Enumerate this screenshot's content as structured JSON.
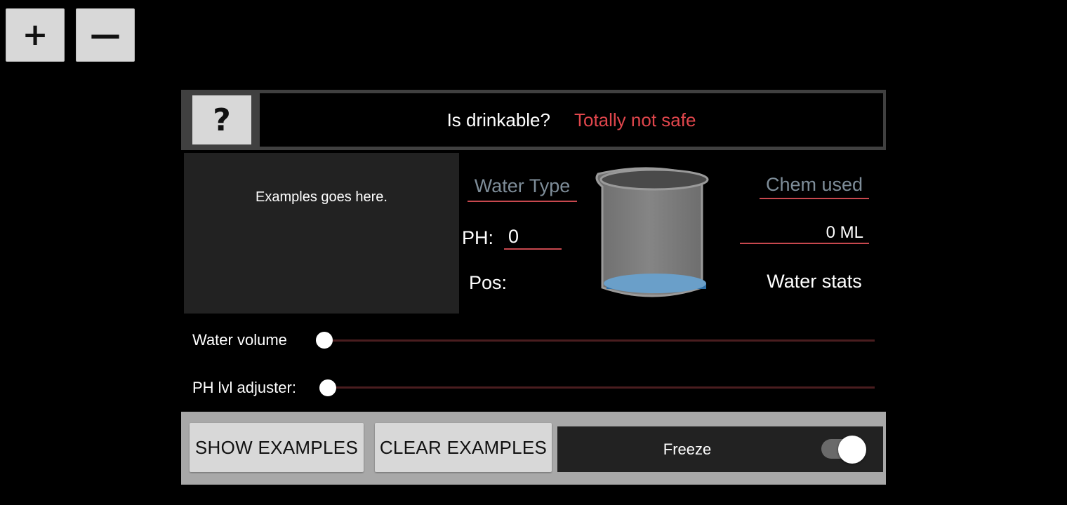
{
  "zoom": {
    "in_label": "+",
    "out_label": "—"
  },
  "header": {
    "help_label": "?",
    "drinkable_label": "Is drinkable?",
    "drinkable_value": "Totally not safe",
    "drinkable_value_color": "#e0464c"
  },
  "examples": {
    "placeholder": "Examples goes here."
  },
  "water": {
    "type_placeholder": "Water Type",
    "ph_label": "PH:",
    "ph_value": "0",
    "pos_label": "Pos:"
  },
  "chem": {
    "placeholder": "Chem used",
    "ml_value": "0 ML",
    "stats_label": "Water stats"
  },
  "sliders": {
    "water_volume": {
      "label": "Water volume",
      "value": 0
    },
    "ph_adjuster": {
      "label": "PH lvl adjuster:",
      "value": 0
    }
  },
  "footer": {
    "show_examples": "SHOW EXAMPLES",
    "clear_examples": "CLEAR EXAMPLES",
    "freeze_label": "Freeze",
    "freeze_on": true
  },
  "icons": {
    "beaker": "beaker-icon"
  },
  "colors": {
    "accent_underline": "#c8484e",
    "placeholder_text": "#7e8d99",
    "water": "#6a9fc9"
  }
}
